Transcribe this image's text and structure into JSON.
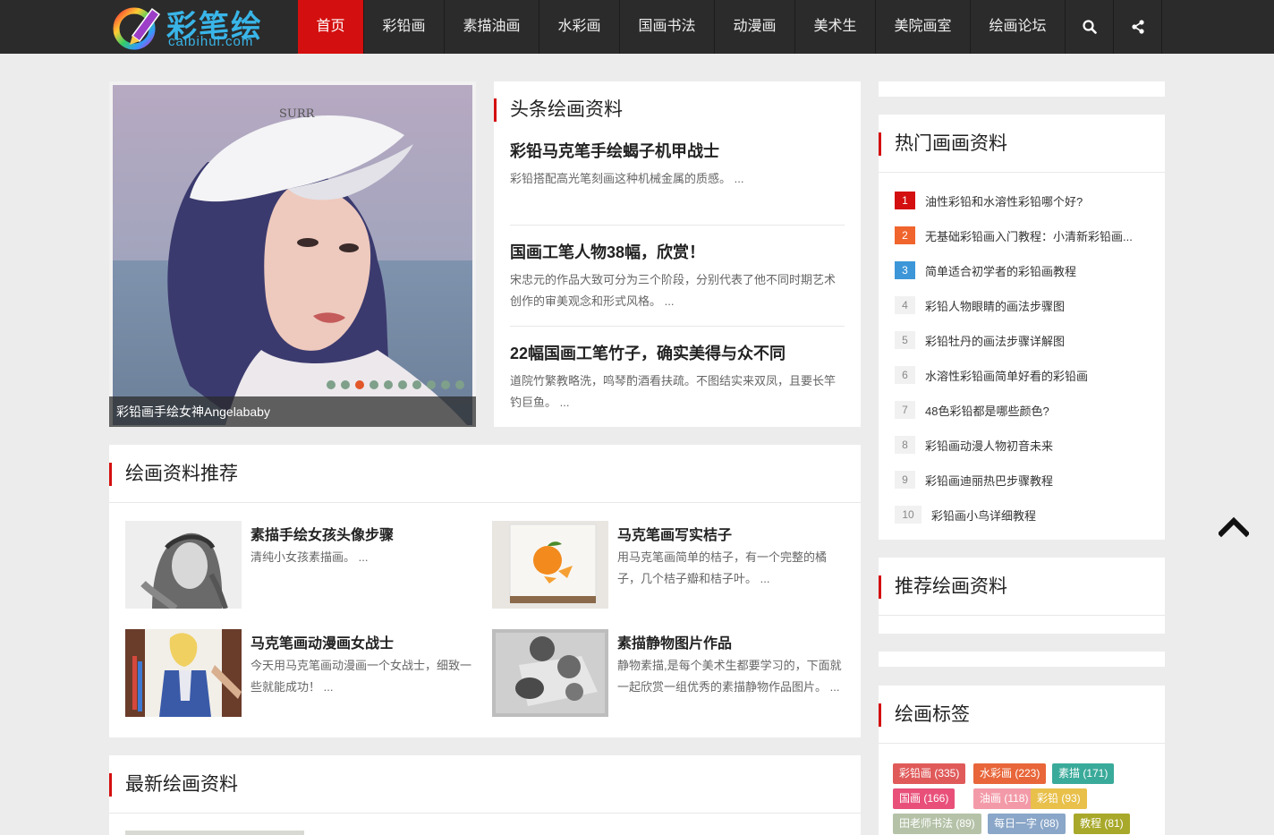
{
  "header": {
    "logo_cn": "彩笔绘",
    "logo_en": "caibihui.com",
    "nav": [
      {
        "label": "首页",
        "active": true
      },
      {
        "label": "彩铅画"
      },
      {
        "label": "素描油画"
      },
      {
        "label": "水彩画"
      },
      {
        "label": "国画书法"
      },
      {
        "label": "动漫画"
      },
      {
        "label": "美术生"
      },
      {
        "label": "美院画室"
      },
      {
        "label": "绘画论坛"
      }
    ],
    "icons": [
      "search-icon",
      "share-icon"
    ]
  },
  "slider": {
    "caption": "彩铅画手绘女神Angelababy",
    "dot_count": 10,
    "active_dot": 3
  },
  "headlines": {
    "title": "头条绘画资料",
    "items": [
      {
        "title": "彩铅马克笔手绘蝎子机甲战士",
        "desc": "彩铅搭配高光笔刻画这种机械金属的质感。 ..."
      },
      {
        "title": "国画工笔人物38幅，欣赏！",
        "desc": "宋忠元的作品大致可分为三个阶段，分别代表了他不同时期艺术创作的审美观念和形式风格。 ..."
      },
      {
        "title": "22幅国画工笔竹子，确实美得与众不同",
        "desc": "道院竹繁教略洗，鸣琴酌酒看扶疏。不图结实来双凤，且要长竿钓巨鱼。 ..."
      }
    ]
  },
  "recommend": {
    "title": "绘画资料推荐",
    "items": [
      {
        "title": "素描手绘女孩头像步骤",
        "desc": "清纯小女孩素描画。 ..."
      },
      {
        "title": "马克笔画写实桔子",
        "desc": "用马克笔画简单的桔子，有一个完整的橘子，几个桔子瓣和桔子叶。 ..."
      },
      {
        "title": "马克笔画动漫画女战士",
        "desc": "今天用马克笔画动漫画一个女战士，细致一些就能成功！ ..."
      },
      {
        "title": "素描静物图片作品",
        "desc": "静物素描,是每个美术生都要学习的，下面就一起欣赏一组优秀的素描静物作品图片。 ..."
      }
    ]
  },
  "latest": {
    "title": "最新绘画资料"
  },
  "sidebar": {
    "hot_title": "热门画画资料",
    "hot_items": [
      {
        "rank": "1",
        "text": "油性彩铅和水溶性彩铅哪个好?"
      },
      {
        "rank": "2",
        "text": "无基础彩铅画入门教程：小清新彩铅画..."
      },
      {
        "rank": "3",
        "text": "简单适合初学者的彩铅画教程"
      },
      {
        "rank": "4",
        "text": "彩铅人物眼睛的画法步骤图"
      },
      {
        "rank": "5",
        "text": "彩铅牡丹的画法步骤详解图"
      },
      {
        "rank": "6",
        "text": "水溶性彩铅画简单好看的彩铅画"
      },
      {
        "rank": "7",
        "text": "48色彩铅都是哪些颜色?"
      },
      {
        "rank": "8",
        "text": "彩铅画动漫人物初音未来"
      },
      {
        "rank": "9",
        "text": "彩铅画迪丽热巴步骤教程"
      },
      {
        "rank": "10",
        "text": "彩铅画小鸟详细教程"
      }
    ],
    "recommend_title": "推荐绘画资料",
    "tags_title": "绘画标签",
    "tags": [
      {
        "label": "彩铅画 (335)",
        "color": "#e05a5a"
      },
      {
        "label": "水彩画 (223)",
        "color": "#e8663a"
      },
      {
        "label": "素描 (171)",
        "color": "#3aaa9a"
      },
      {
        "label": "国画 (166)",
        "color": "#e8507a"
      },
      {
        "label": "油画 (118)",
        "color": "#f39aa8"
      },
      {
        "label": "彩铅 (93)",
        "color": "#e8c04a"
      },
      {
        "label": "田老师书法 (89)",
        "color": "#b5c2a8"
      },
      {
        "label": "每日一字 (88)",
        "color": "#8aa6c8"
      },
      {
        "label": "教程 (81)",
        "color": "#a8a82a"
      }
    ]
  },
  "colors": {
    "accent": "#d40f0f",
    "header_bg": "#2b2b2b",
    "page_bg": "#ececec"
  }
}
